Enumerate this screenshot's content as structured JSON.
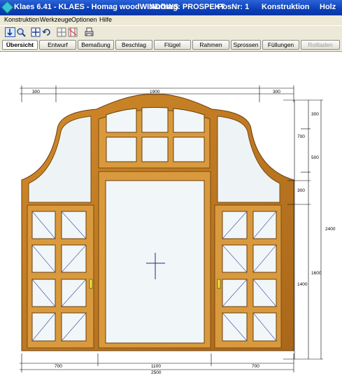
{
  "window": {
    "title_app": "Klaes 6.41 - KLAES - Homag woodWINDOWS",
    "title_order": "Auftrag: PROSPEKT",
    "title_pos": "PosNr: 1",
    "title_mode": "Konstruktion",
    "title_material": "Holz"
  },
  "menu": [
    "Konstruktion",
    "Werkzeuge",
    "Optionen",
    "Hilfe"
  ],
  "toolbar_icons": [
    "pointer-icon",
    "zoom-icon",
    "move-icon",
    "undo-icon",
    "split-icon",
    "column-icon",
    "print-icon"
  ],
  "tabs": [
    {
      "label": "Übersicht",
      "state": "active"
    },
    {
      "label": "Entwurf",
      "state": "normal"
    },
    {
      "label": "Bemaßung",
      "state": "normal"
    },
    {
      "label": "Beschlag",
      "state": "normal"
    },
    {
      "label": "Flügel",
      "state": "normal"
    },
    {
      "label": "Rahmen",
      "state": "normal"
    },
    {
      "label": "Sprossen",
      "state": "normal"
    },
    {
      "label": "Füllungen",
      "state": "normal"
    },
    {
      "label": "Rollladen",
      "state": "disabled"
    }
  ],
  "dimensions": {
    "top_left": "300",
    "top_center": "1900",
    "top_right": "300",
    "bottom_left": "700",
    "bottom_center": "1100",
    "bottom_right": "700",
    "bottom_total": "2500",
    "right_arch_300": "300",
    "right_arch_700": "700",
    "right_arch_500": "500",
    "right_mid_300": "300",
    "right_lower": "1600",
    "right_sash": "1400",
    "right_total": "2400"
  },
  "colors": {
    "frame_wood": "#b8741b",
    "frame_inner": "#d9a24a",
    "glass": "#eef4f6",
    "title_bar": "#0a3fb8"
  }
}
